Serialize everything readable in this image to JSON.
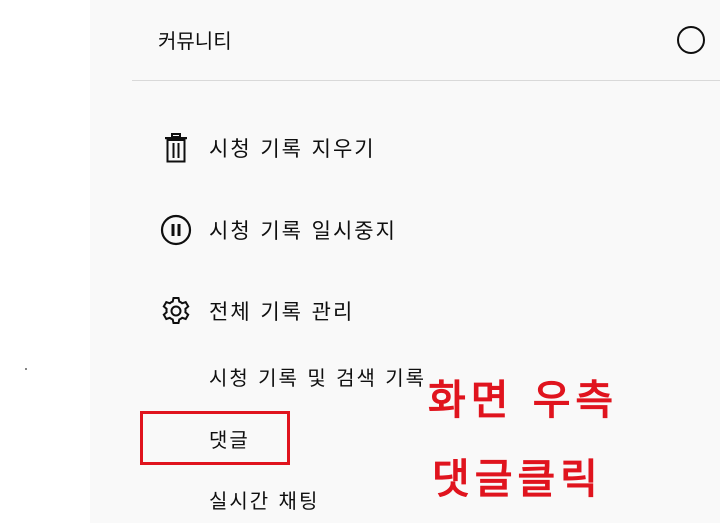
{
  "header": {
    "title": "커뮤니티"
  },
  "menu": {
    "items": [
      {
        "label": "시청 기록 지우기",
        "icon": "trash-icon"
      },
      {
        "label": "시청 기록 일시중지",
        "icon": "pause-icon"
      },
      {
        "label": "전체 기록 관리",
        "icon": "gear-icon"
      }
    ],
    "sub_items": [
      {
        "label": "시청 기록 및 검색 기록"
      },
      {
        "label": "댓글"
      },
      {
        "label": "실시간 채팅"
      }
    ]
  },
  "annotation": {
    "line1": "화면 우측",
    "line2": "댓글클릭"
  },
  "colors": {
    "panel_bg": "#f9f9f9",
    "text": "#0f0f0f",
    "annotation": "#e0141e",
    "divider": "#d9d9d9"
  }
}
